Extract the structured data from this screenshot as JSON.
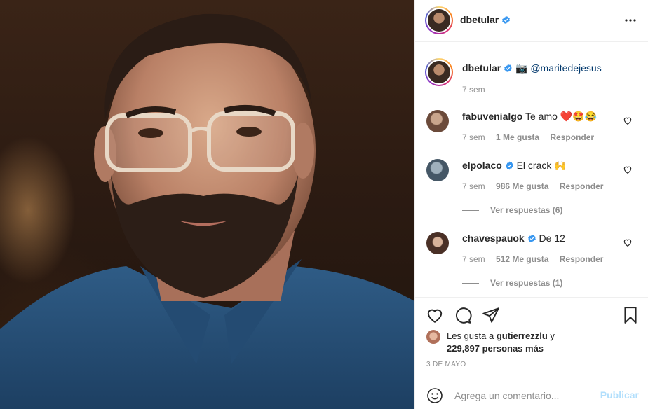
{
  "post": {
    "author": "dbetular",
    "author_verified": true,
    "photo_alt": "Retrato de hombre con barba y lentes transparentes, camisa de mezclilla"
  },
  "caption": {
    "username": "dbetular",
    "camera_emoji": "📷",
    "mention": "@maritedejesus",
    "time": "7 sem"
  },
  "comments": [
    {
      "username": "fabuvenialgo",
      "verified": false,
      "text": "Te amo ❤️🤩😂",
      "time": "7 sem",
      "likes": "1 Me gusta",
      "reply_label": "Responder",
      "view_replies": ""
    },
    {
      "username": "elpolaco",
      "verified": true,
      "text": "El crack 🙌",
      "time": "7 sem",
      "likes": "986 Me gusta",
      "reply_label": "Responder",
      "view_replies": "Ver respuestas (6)"
    },
    {
      "username": "chavespauok",
      "verified": true,
      "text": "De 12",
      "time": "7 sem",
      "likes": "512 Me gusta",
      "reply_label": "Responder",
      "view_replies": "Ver respuestas (1)"
    }
  ],
  "likes_summary": {
    "prefix": "Les gusta a ",
    "user": "gutierrezzlu",
    "connector": " y",
    "count": "229,897 personas más"
  },
  "date": "3 DE MAYO",
  "add_comment": {
    "placeholder": "Agrega un comentario...",
    "publish_label": "Publicar"
  },
  "icons": {
    "more": "more-horizontal-icon",
    "like": "heart-icon",
    "comment": "comment-icon",
    "share": "share-icon",
    "save": "bookmark-icon",
    "emoji": "emoji-icon",
    "verified": "verified-badge-icon"
  },
  "colors": {
    "verified_blue": "#3897f0",
    "link_blue": "#00376b",
    "muted": "#8e8e8e",
    "publish_disabled": "#b2dffc",
    "heart_red": "#ed4956"
  }
}
